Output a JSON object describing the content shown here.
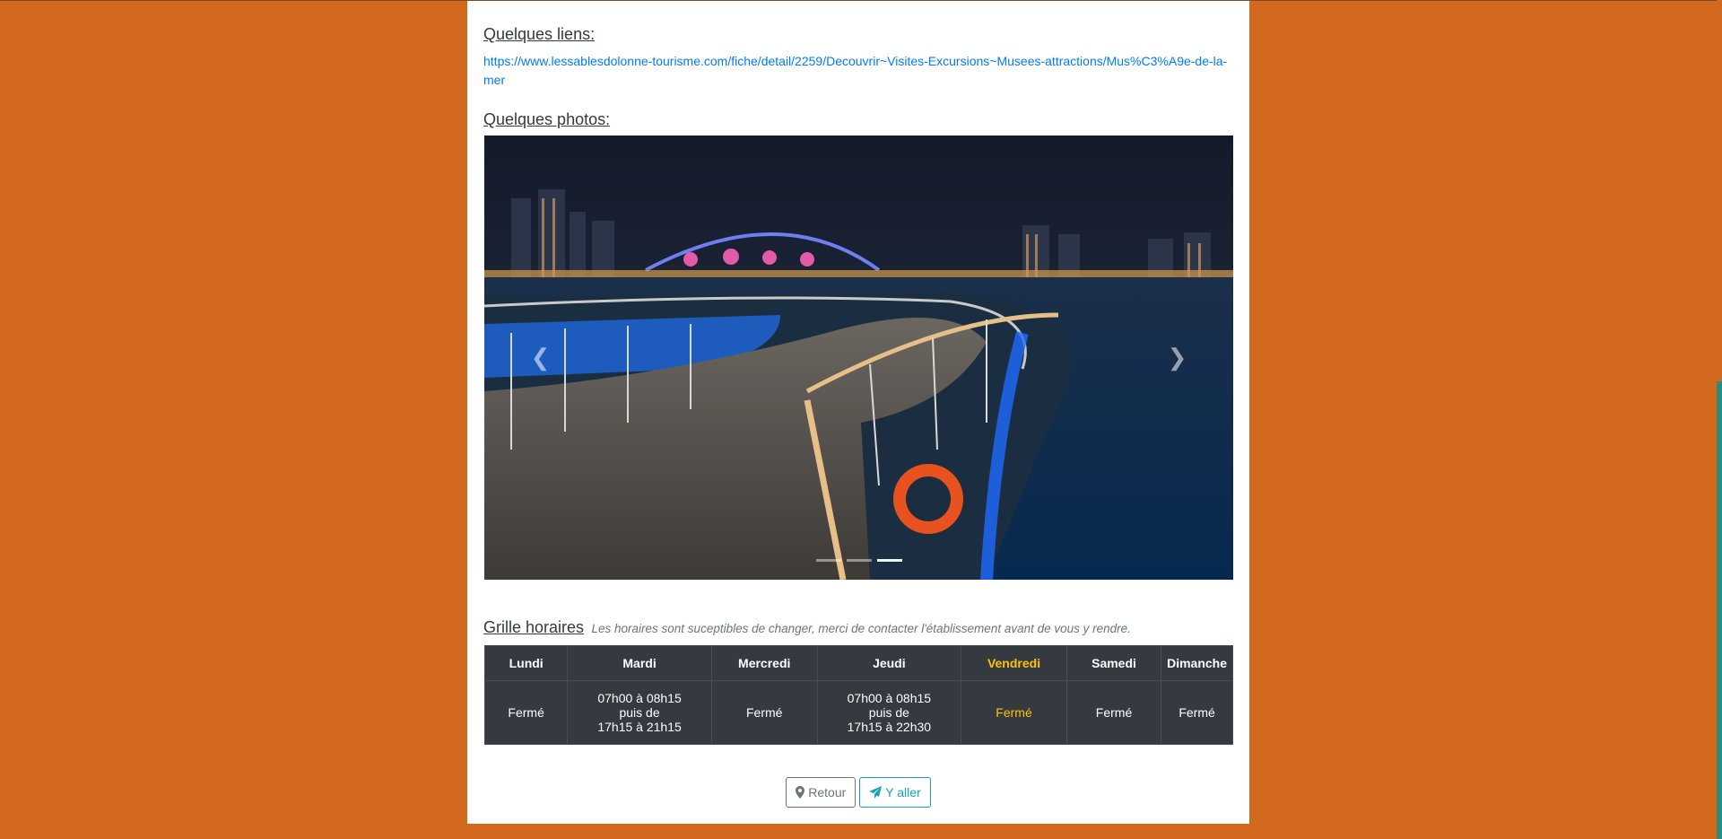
{
  "links_section": {
    "title": "Quelques liens:",
    "url": "https://www.lessablesdolonne-tourisme.com/fiche/detail/2259/Decouvrir~Visites-Excursions~Musees-attractions/Mus%C3%A9e-de-la-mer"
  },
  "photos_section": {
    "title": "Quelques photos:",
    "prev_icon": "chevron-left-icon",
    "next_icon": "chevron-right-icon",
    "slide_count": 3,
    "active_slide": 3
  },
  "schedule": {
    "title": "Grille horaires",
    "note": "Les horaires sont suceptibles de changer, merci de contacter l'établissement avant de vous y rendre.",
    "days": [
      "Lundi",
      "Mardi",
      "Mercredi",
      "Jeudi",
      "Vendredi",
      "Samedi",
      "Dimanche"
    ],
    "hours": [
      [
        "Fermé"
      ],
      [
        "07h00 à 08h15",
        "puis de",
        "17h15 à 21h15"
      ],
      [
        "Fermé"
      ],
      [
        "07h00 à 08h15",
        "puis de",
        "17h15 à 22h30"
      ],
      [
        "Fermé"
      ],
      [
        "Fermé"
      ],
      [
        "Fermé"
      ]
    ],
    "today_color": "#ffc107"
  },
  "actions": {
    "back_label": "Retour",
    "back_icon": "map-marker-icon",
    "go_label": "Y aller",
    "go_icon": "paper-plane-icon"
  },
  "colors": {
    "page_background": "#d2691e",
    "table_background": "#343a40",
    "link": "#007bff",
    "go_button": "#17a2b8"
  }
}
